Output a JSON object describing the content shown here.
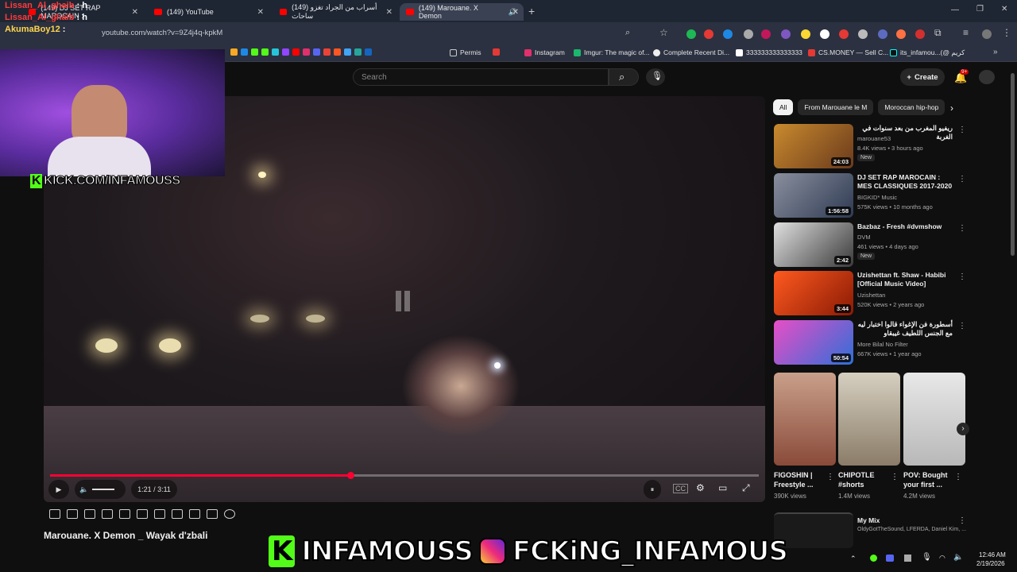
{
  "browser": {
    "tabs": [
      {
        "label": "(149) DJ SET RAP MAROCAIN :"
      },
      {
        "label": "(149) YouTube"
      },
      {
        "label": "(149) أسراب من الجراد تغزو ساحات"
      },
      {
        "label": "(149) Marouane. X Demon"
      }
    ],
    "url": "youtube.com/watch?v=9Z4j4q-kpkM",
    "bookmarks": [
      {
        "label": "Permis"
      },
      {
        "label": "Instagram"
      },
      {
        "label": "Imgur: The magic of..."
      },
      {
        "label": "Complete Recent Di..."
      },
      {
        "label": "333333333333333"
      },
      {
        "label": "CS.MONEY — Sell C..."
      },
      {
        "label": "its_infamou...(@ كريم"
      }
    ]
  },
  "youtube": {
    "search_placeholder": "Search",
    "create_label": "Create",
    "notifications_badge": "9+",
    "video": {
      "title": "Marouane. X Demon _ Wayak d'zbali",
      "time": "1:21 / 3:11",
      "progress_fraction": 0.424
    },
    "chips": [
      "All",
      "From Marouane le M",
      "Moroccan hip-hop"
    ],
    "recommendations": [
      {
        "title": "ريفيو المغرب من بعد سنوات في الغربة",
        "channel": "marouane53",
        "meta": "8.4K views • 3 hours ago",
        "duration": "24:03",
        "badge": "New"
      },
      {
        "title": "DJ SET RAP MAROCAIN : MES CLASSIQUES 2017-2020",
        "channel": "BIGKID* Music",
        "meta": "575K views • 10 months ago",
        "duration": "1:56:58",
        "badge": ""
      },
      {
        "title": "Bazbaz - Fresh #dvmshow",
        "channel": "DVM",
        "meta": "461 views • 4 days ago",
        "duration": "2:42",
        "badge": "New"
      },
      {
        "title": "Uzishettan ft. Shaw - Habibi [Official Music Video]",
        "channel": "Uzishettan",
        "meta": "520K views • 2 years ago",
        "duration": "3:44",
        "badge": ""
      },
      {
        "title": "أسطورة فن الإغواء قالوا اختبار ليه مع الجنس اللطيف غيبقاو",
        "channel": "More Bilal No Filter",
        "meta": "667K views • 1 year ago",
        "duration": "50:54",
        "badge": ""
      }
    ],
    "shorts": [
      {
        "title": "FIGOSHIN | Freestyle ...",
        "views": "390K views"
      },
      {
        "title": "CHIPOTLE #shorts",
        "views": "1.4M views"
      },
      {
        "title": "POV: Bought your first ...",
        "views": "4.2M views"
      }
    ],
    "mix": {
      "title": "My Mix",
      "meta": "OldyGotTheSound, LFERDA, Daniel Kim, ..."
    }
  },
  "overlay": {
    "chat": [
      {
        "user": "Lissan_Al_ghaib",
        "msg": ": h"
      },
      {
        "user": "Lissan_Al_ghaib",
        "msg": ": h"
      },
      {
        "user": "AkumaBoy12",
        "msg": ":"
      }
    ],
    "kick_url": "KICK.COM/INFAMOUSS",
    "banner_kick": "INFAMOUSS",
    "banner_ig": "FCKiNG_INFAMOUS"
  },
  "taskbar": {
    "time": "12:46 AM",
    "date": "2/19/2026"
  },
  "colors": {
    "youtube_red": "#ff0033",
    "kick_green": "#53fc18",
    "bg": "#0f0f0f"
  }
}
